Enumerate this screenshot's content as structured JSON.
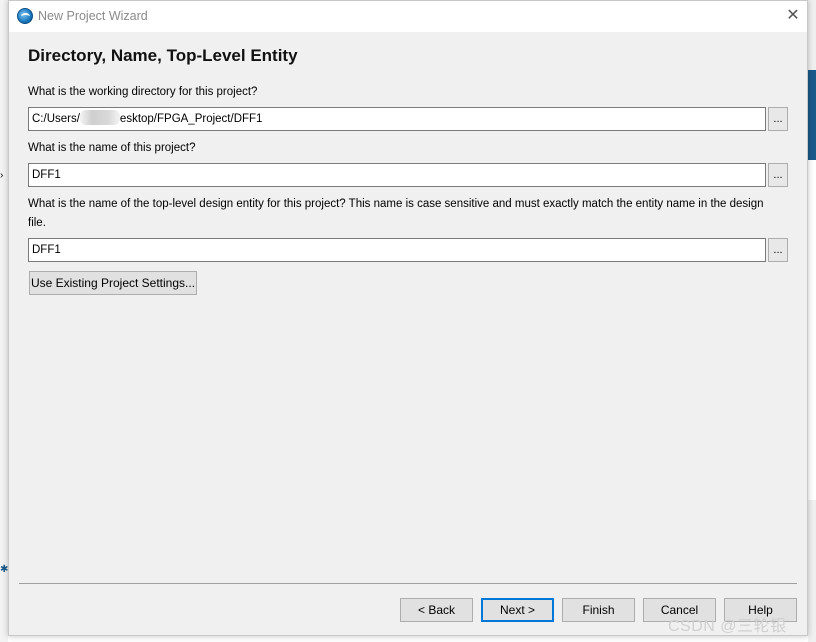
{
  "window": {
    "title": "New Project Wizard",
    "close_glyph": "✕"
  },
  "page": {
    "heading": "Directory, Name, Top-Level Entity"
  },
  "fields": {
    "directory": {
      "label": "What is the working directory for this project?",
      "value_prefix": "C:/Users/",
      "value_suffix": "esktop/FPGA_Project/DFF1",
      "browse_label": "..."
    },
    "project_name": {
      "label": "What is the name of this project?",
      "value": "DFF1",
      "browse_label": "..."
    },
    "top_level_entity": {
      "label": "What is the name of the top-level design entity for this project? This name is case sensitive and must exactly match the entity name in the design file.",
      "value": "DFF1",
      "browse_label": "..."
    }
  },
  "buttons": {
    "use_existing": "Use Existing Project Settings...",
    "back": "< Back",
    "next": "Next >",
    "finish": "Finish",
    "cancel": "Cancel",
    "help": "Help"
  },
  "watermark": "CSDN @三轮银",
  "icons": [
    "app-icon",
    "close-icon"
  ]
}
